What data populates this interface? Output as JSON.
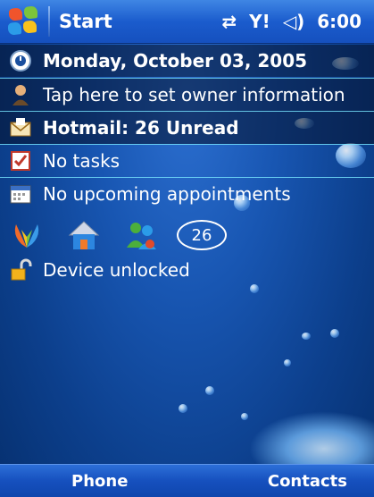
{
  "topbar": {
    "start_label": "Start",
    "time": "6:00",
    "icons": [
      "connectivity-icon",
      "signal-icon",
      "speaker-icon"
    ]
  },
  "today": {
    "date": "Monday, October 03, 2005",
    "owner": "Tap here to set owner information",
    "mail": "Hotmail: 26 Unread",
    "tasks": "No tasks",
    "appointments": "No upcoming appointments",
    "unread_badge": "26",
    "lock": "Device unlocked"
  },
  "softkeys": {
    "left": "Phone",
    "right": "Contacts"
  },
  "colors": {
    "taskbar": "#1b5ccd",
    "background": "#1856b2",
    "row_separator": "#78e6ff"
  }
}
